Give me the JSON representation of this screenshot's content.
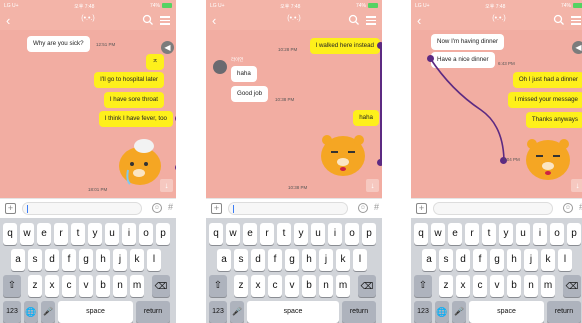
{
  "status": {
    "carrier": "LG U+",
    "clock": "오후 7:48",
    "battery": "74%"
  },
  "nav": {
    "title": "(•.•.)",
    "back_icon": "back-chevron-icon",
    "search_icon": "search-icon",
    "menu_icon": "menu-icon"
  },
  "screens": [
    {
      "messages": [
        {
          "text": "Why are you sick?",
          "side": "incoming",
          "time": "12:51 PM"
        },
        {
          "text": "ㅈ",
          "side": "outgoing"
        },
        {
          "text": "I'll go to hospital later",
          "side": "outgoing"
        },
        {
          "text": "I have sore throat",
          "side": "outgoing"
        },
        {
          "text": "I think I have fever, too",
          "side": "outgoing"
        }
      ],
      "bottom_time": "18:01 PM"
    },
    {
      "sender": "라이언",
      "messages": [
        {
          "text": "I walked here instead",
          "side": "outgoing",
          "time": "10:28 PM"
        },
        {
          "text": "haha",
          "side": "incoming"
        },
        {
          "text": "Good job",
          "side": "incoming",
          "time": "10:38 PM"
        },
        {
          "text": "haha",
          "side": "outgoing"
        }
      ],
      "bottom_time": "10:38 PM"
    },
    {
      "messages": [
        {
          "text": "Now I'm having dinner",
          "side": "incoming"
        },
        {
          "text": "Have a nice dinner",
          "side": "incoming",
          "time": "6:43 PM"
        },
        {
          "text": "Oh I just had a dinner",
          "side": "outgoing"
        },
        {
          "text": "I missed your message",
          "side": "outgoing"
        },
        {
          "text": "Thanks anyways",
          "side": "outgoing"
        }
      ],
      "bottom_time": "7:04 PM"
    }
  ],
  "keyboard": {
    "row1": [
      "q",
      "w",
      "e",
      "r",
      "t",
      "y",
      "u",
      "i",
      "o",
      "p"
    ],
    "row2": [
      "a",
      "s",
      "d",
      "f",
      "g",
      "h",
      "j",
      "k",
      "l"
    ],
    "row3": [
      "z",
      "x",
      "c",
      "v",
      "b",
      "n",
      "m"
    ],
    "numbers_key": "123",
    "space_key": "space",
    "return_key": "return",
    "shift_icon": "shift-icon",
    "delete_icon": "delete-icon",
    "globe_icon": "globe-icon",
    "mic_icon": "microphone-icon"
  },
  "input": {
    "plus_icon": "plus-icon",
    "emoji_icon": "emoji-icon",
    "hash_label": "#"
  },
  "colors": {
    "chat_bg": "#f2ada2",
    "header_bg": "#f3b4a8",
    "outgoing": "#fef01b",
    "incoming": "#ffffff",
    "annotation": "#5c2a82"
  }
}
